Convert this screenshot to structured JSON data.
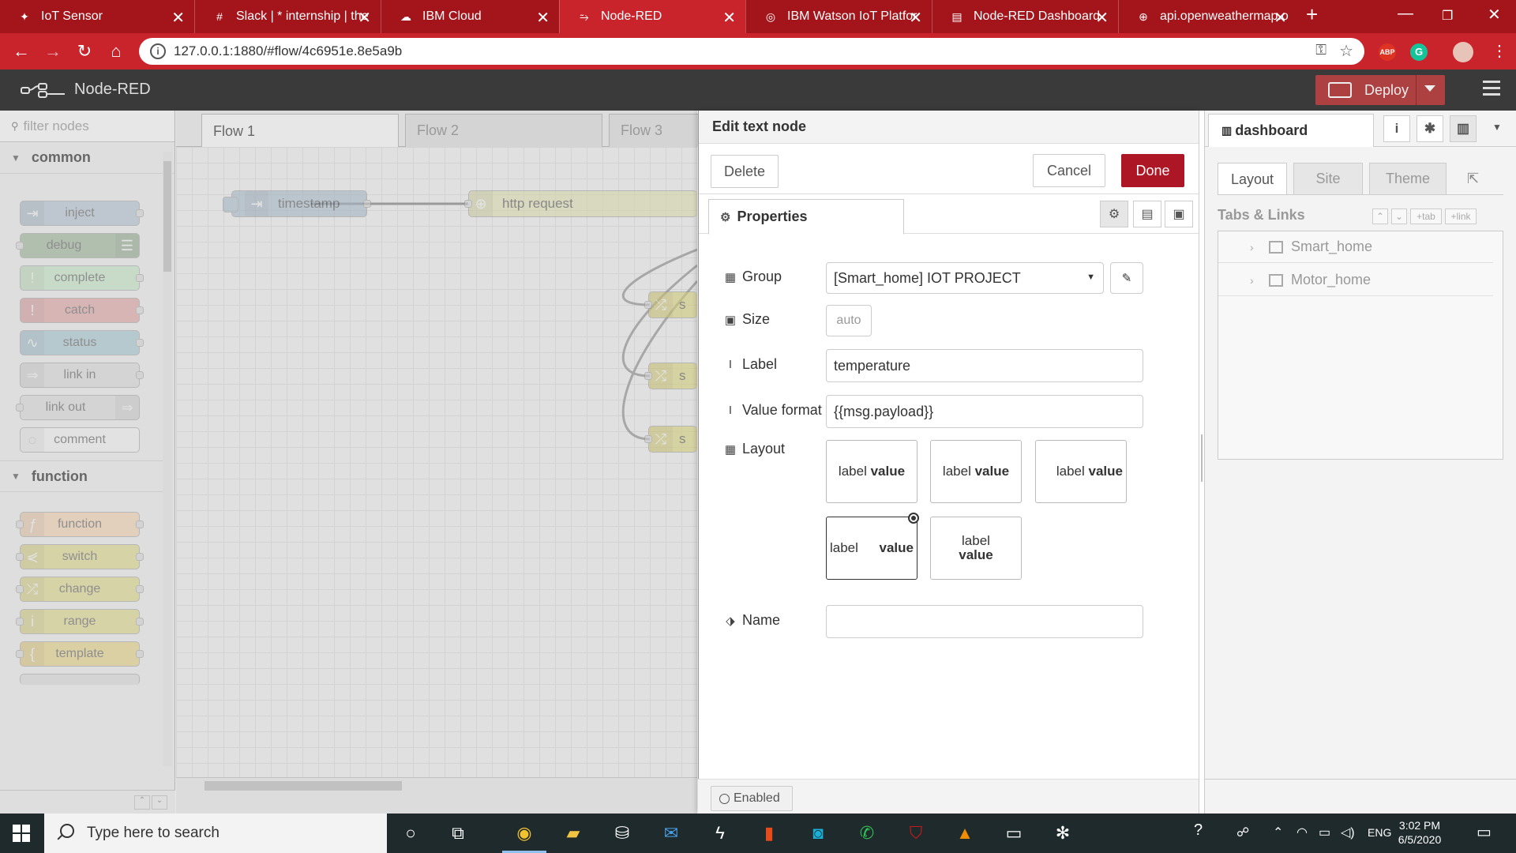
{
  "browser": {
    "tabs": [
      {
        "title": "IoT Sensor",
        "icon": "gear-icon"
      },
      {
        "title": "Slack | * internship | the",
        "icon": "slack-icon"
      },
      {
        "title": "IBM Cloud",
        "icon": "cloud-icon"
      },
      {
        "title": "Node-RED",
        "icon": "node-red-icon"
      },
      {
        "title": "IBM Watson IoT Platfor",
        "icon": "watson-icon"
      },
      {
        "title": "Node-RED Dashboard",
        "icon": "dashboard-icon"
      },
      {
        "title": "api.openweathermap.o",
        "icon": "globe-icon"
      }
    ],
    "url": "127.0.0.1:1880/#flow/4c6951e.8e5a9b",
    "extensions": {
      "abp": "ABP",
      "grammarly": "G"
    }
  },
  "header": {
    "app_title": "Node-RED",
    "deploy_label": "Deploy"
  },
  "palette": {
    "search_placeholder": "filter nodes",
    "categories": [
      {
        "name": "common",
        "nodes": [
          "inject",
          "debug",
          "complete",
          "catch",
          "status",
          "link in",
          "link out",
          "comment"
        ]
      },
      {
        "name": "function",
        "nodes": [
          "function",
          "switch",
          "change",
          "range",
          "template"
        ]
      }
    ],
    "node_colors": {
      "inject": "#a6bbcf",
      "debug": "#87a980",
      "complete": "#c0edc0",
      "catch": "#e49191",
      "status": "#94c1d0",
      "link": "#dddddd",
      "comment": "#ffffff",
      "function": "#fdd0a2",
      "change": "#e2d96e",
      "template": "#ebd168"
    }
  },
  "workspace": {
    "tabs": [
      "Flow 1",
      "Flow 2",
      "Flow 3"
    ],
    "nodes": [
      {
        "label": "timestamp"
      },
      {
        "label": "http request"
      },
      {
        "label": "s"
      },
      {
        "label": "s"
      },
      {
        "label": "s"
      }
    ]
  },
  "tray": {
    "title": "Edit text node",
    "delete_label": "Delete",
    "cancel_label": "Cancel",
    "done_label": "Done",
    "properties_tab": "Properties",
    "fields": {
      "group_label": "Group",
      "group_value": "[Smart_home] IOT PROJECT",
      "size_label": "Size",
      "size_value": "auto",
      "label_label": "Label",
      "label_value": "temperature",
      "format_label": "Value format",
      "format_value": "{{msg.payload}}",
      "layout_label": "Layout",
      "name_label": "Name",
      "name_value": ""
    },
    "layout_options": [
      {
        "label": "label",
        "value": "value"
      },
      {
        "label": "label",
        "value": "value"
      },
      {
        "label": "label",
        "value": "value"
      },
      {
        "label": "label",
        "value": "value",
        "selected": true
      },
      {
        "label": "label",
        "value": "value"
      }
    ],
    "enabled_label": "Enabled"
  },
  "sidebar": {
    "tab_label": "dashboard",
    "subtabs": [
      "Layout",
      "Site",
      "Theme"
    ],
    "section_title": "Tabs & Links",
    "mini_buttons": [
      "+tab",
      "+link"
    ],
    "tree_items": [
      "Smart_home",
      "Motor_home"
    ]
  },
  "taskbar": {
    "search_placeholder": "Type here to search",
    "language": "ENG",
    "time": "3:02 PM",
    "date": "6/5/2020"
  },
  "colors": {
    "browser_red": "#c9242c",
    "tab_strip": "#a3151b",
    "nr_header": "#3a3a3a",
    "deploy": "#ad4040",
    "done": "#ad1625"
  }
}
